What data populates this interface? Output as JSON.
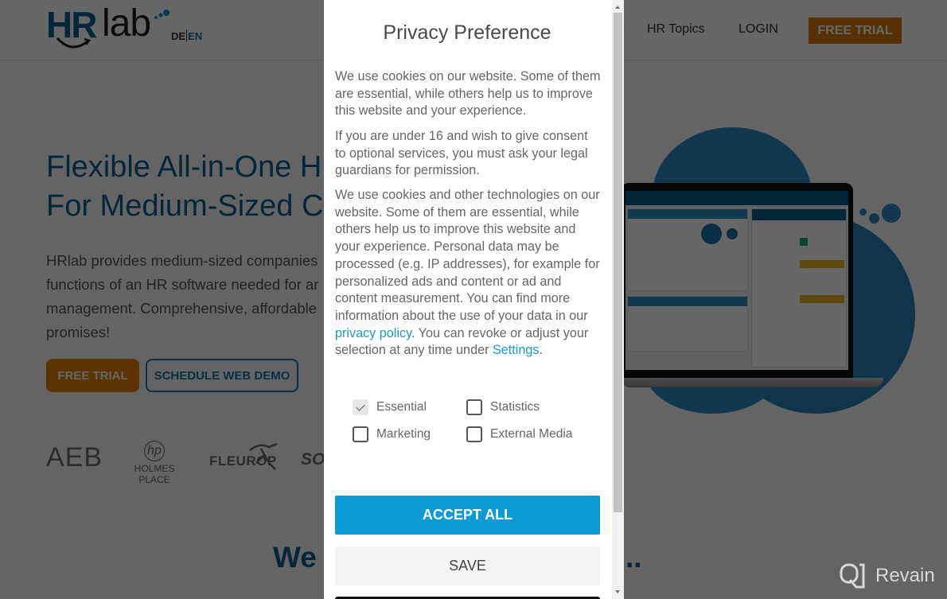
{
  "header": {
    "logo": {
      "hr": "HR",
      "lab": "lab"
    },
    "languages": {
      "de": "DE",
      "en": "EN"
    },
    "nav_partial": "e",
    "nav": [
      {
        "label": "HR Topics"
      },
      {
        "label": "LOGIN"
      }
    ],
    "cta_label": "FREE TRIAL"
  },
  "hero": {
    "title_line1": "Flexible All-in-One HR",
    "title_line2": "For Medium-Sized Co",
    "text_line1": "HRlab provides medium-sized companies",
    "text_line2": "functions of an HR software needed for ar",
    "text_line3": "management. Comprehensive, affordable",
    "text_line4": "promises!",
    "free_trial_label": "FREE TRIAL",
    "demo_label": "SCHEDULE WEB DEMO"
  },
  "clients": {
    "aeb": "AEB",
    "holmes_mark": "hp",
    "holmes": "HOLMES PLACE",
    "fleurop": "FLEUROP",
    "so": "SO"
  },
  "section": {
    "title_left": "We",
    "title_right": "ur ..."
  },
  "watermark": {
    "label": "Revain"
  },
  "colors": {
    "brand_blue": "#0b5f8f",
    "accent_orange": "#e48306",
    "accept_blue": "#0a9ad4",
    "link": "#1a9ac9"
  },
  "modal": {
    "title": "Privacy Preference",
    "paragraph1": "We use cookies on our website. Some of them are essential, while others help us to improve this website and your experience.",
    "paragraph2": "If you are under 16 and wish to give consent to optional services, you must ask your legal guardians for permission.",
    "paragraph3_before": "We use cookies and other technologies on our website. Some of them are essential, while others help us to improve this website and your experience. Personal data may be processed (e.g. IP addresses), for example for personalized ads and content or ad and content measurement. You can find more information about the use of your data in our ",
    "privacy_link": "privacy policy",
    "paragraph3_middle": ". You can revoke or adjust your selection at any time under ",
    "settings_link": "Settings",
    "paragraph3_after": ".",
    "checkboxes": [
      {
        "label": "Essential",
        "checked": true,
        "disabled": true
      },
      {
        "label": "Statistics",
        "checked": false
      },
      {
        "label": "Marketing",
        "checked": false
      },
      {
        "label": "External Media",
        "checked": false
      }
    ],
    "accept_all_label": "ACCEPT ALL",
    "save_label": "SAVE"
  }
}
